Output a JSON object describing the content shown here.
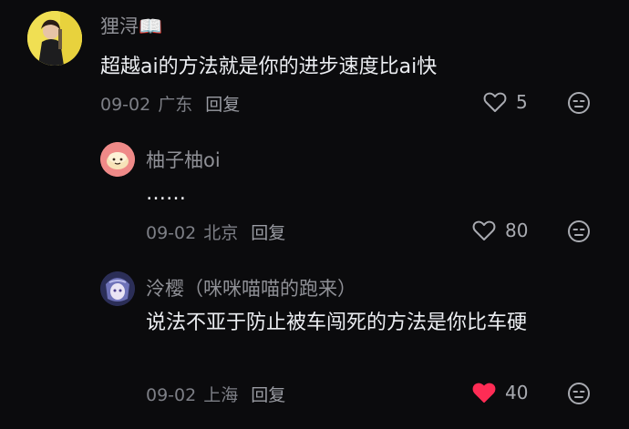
{
  "comments": [
    {
      "username": "狸浔📖",
      "text": "超越ai的方法就是你的进步速度比ai快",
      "date": "09-02",
      "location": "广东",
      "reply_label": "回复",
      "like_count": "5",
      "liked": false,
      "avatar_icon": "user-photo-avatar"
    },
    {
      "username": "柚子柚oi",
      "text": "……",
      "date": "09-02",
      "location": "北京",
      "reply_label": "回复",
      "like_count": "80",
      "liked": false,
      "avatar_icon": "bread-avatar"
    },
    {
      "username": "泠樱（咪咪喵喵的跑来）",
      "text": "说法不亚于防止被车闯死的方法是你比车硬",
      "date": "09-02",
      "location": "上海",
      "reply_label": "回复",
      "like_count": "40",
      "liked": true,
      "avatar_icon": "anime-avatar"
    }
  ],
  "colors": {
    "background": "#0b0b0d",
    "liked_heart": "#fe2c55",
    "text": "#eceef2",
    "muted": "#7d7f86"
  }
}
